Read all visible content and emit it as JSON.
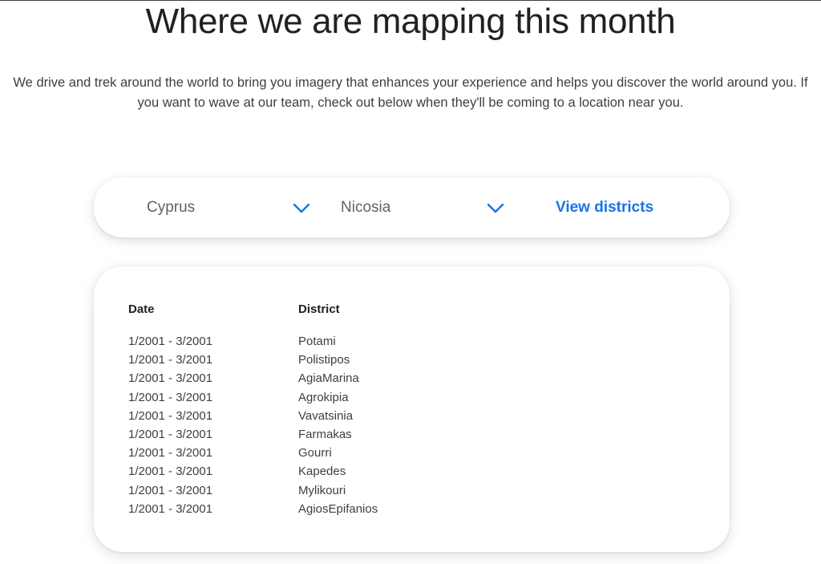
{
  "header": {
    "title": "Where we are mapping this month",
    "description": "We drive and trek around the world to bring you imagery that enhances your experience and helps you discover the world around you. If you want to wave at our team, check out below when they'll be coming to a location near you."
  },
  "selector": {
    "country": "Cyprus",
    "city": "Nicosia",
    "view_label": "View districts",
    "chevron_icon": "chevron-down-icon",
    "accent_color": "#1a73e8"
  },
  "table": {
    "headers": {
      "date": "Date",
      "district": "District"
    },
    "rows": [
      {
        "date": "1/2001 - 3/2001",
        "district": "Potami"
      },
      {
        "date": "1/2001 - 3/2001",
        "district": "Polistipos"
      },
      {
        "date": "1/2001 - 3/2001",
        "district": "AgiaMarina"
      },
      {
        "date": "1/2001 - 3/2001",
        "district": "Agrokipia"
      },
      {
        "date": "1/2001 - 3/2001",
        "district": "Vavatsinia"
      },
      {
        "date": "1/2001 - 3/2001",
        "district": "Farmakas"
      },
      {
        "date": "1/2001 - 3/2001",
        "district": "Gourri"
      },
      {
        "date": "1/2001 - 3/2001",
        "district": "Kapedes"
      },
      {
        "date": "1/2001 - 3/2001",
        "district": "Mylikouri"
      },
      {
        "date": "1/2001 - 3/2001",
        "district": "AgiosEpifanios"
      }
    ]
  }
}
